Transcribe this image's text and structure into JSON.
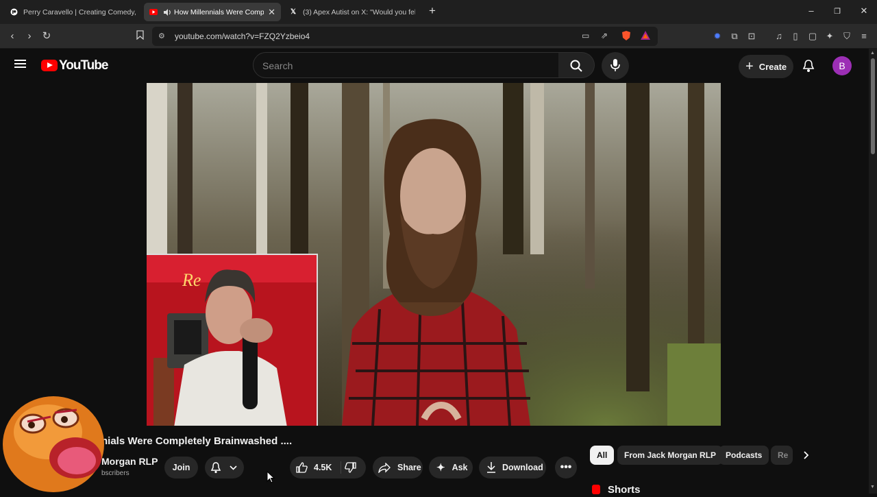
{
  "browser": {
    "tabs": [
      {
        "title": "Perry Caravello | Creating Comedy, V",
        "favicon": "patreon-icon"
      },
      {
        "title": "How Millennials Were Comple",
        "favicon": "youtube-icon",
        "active": true,
        "audio": true
      },
      {
        "title": "(3) Apex Autist on X: \"Would you fel",
        "favicon": "x-icon"
      }
    ],
    "url": "youtube.com/watch?v=FZQ2Yzbeio4"
  },
  "youtube": {
    "logo_text": "YouTube",
    "search_placeholder": "Search",
    "create_label": "Create",
    "avatar_letter": "B"
  },
  "video": {
    "title": "nials Were Completely Brainwashed ....",
    "channel_name": "Morgan RLP",
    "channel_subs": "bscribers",
    "join_label": "Join",
    "like_count": "4.5K",
    "share_label": "Share",
    "ask_label": "Ask",
    "download_label": "Download",
    "pip_neon_text": "Re"
  },
  "chips": [
    "All",
    "From Jack Morgan RLP",
    "Podcasts",
    "Re"
  ],
  "shorts_label": "Shorts",
  "colors": {
    "yt_red": "#ff0000",
    "avatar": "#9c2fb5",
    "bg": "#0f0f0f"
  }
}
